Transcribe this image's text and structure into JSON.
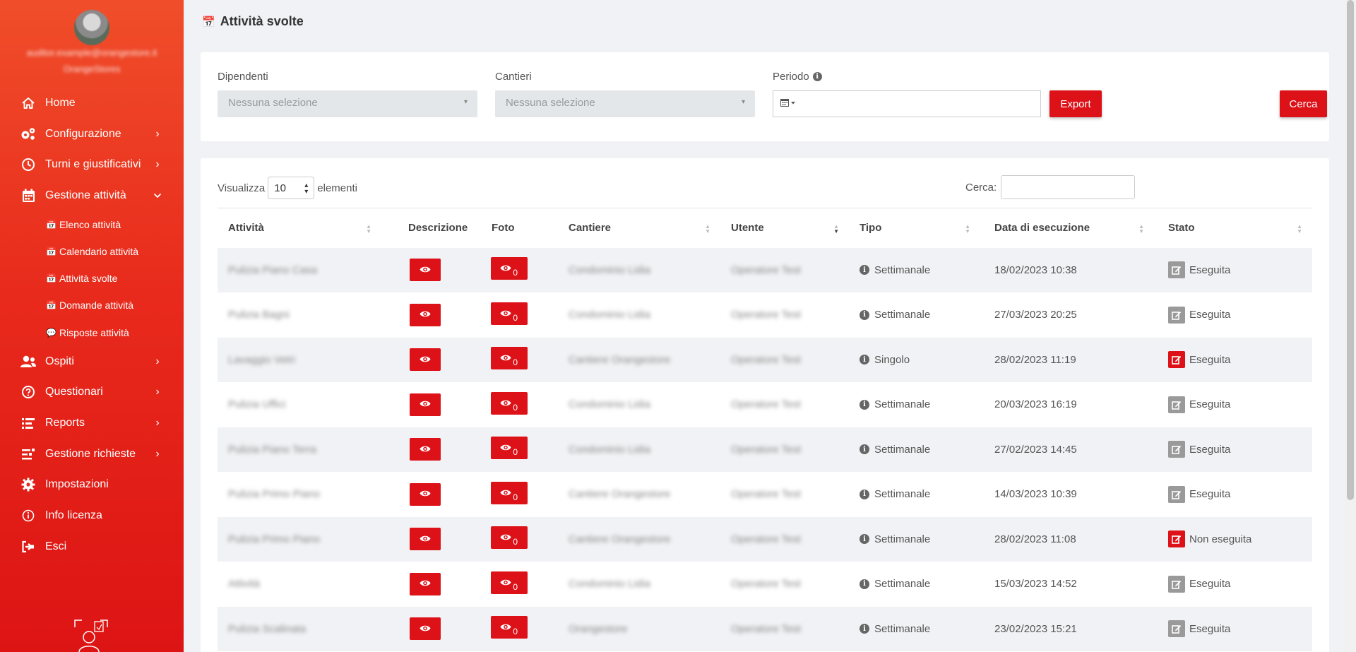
{
  "sidebar": {
    "email": "auditor.example@orangestore.it",
    "company": "OrangeStores",
    "nav": [
      {
        "label": "Home",
        "icon": "home-icon",
        "chevron": ""
      },
      {
        "label": "Configurazione",
        "icon": "gears-icon",
        "chevron": "›"
      },
      {
        "label": "Turni e giustificativi",
        "icon": "clock-icon",
        "chevron": "›"
      },
      {
        "label": "Gestione attività",
        "icon": "calendar-icon",
        "chevron": "⌄"
      }
    ],
    "subnav": [
      {
        "label": "Elenco attività",
        "icon": "calendar-small-icon"
      },
      {
        "label": "Calendario attività",
        "icon": "calendar-small-icon"
      },
      {
        "label": "Attività svolte",
        "icon": "calendar-check-icon"
      },
      {
        "label": "Domande attività",
        "icon": "calendar-question-icon"
      },
      {
        "label": "Risposte attività",
        "icon": "comment-icon"
      }
    ],
    "nav_bottom": [
      {
        "label": "Ospiti",
        "icon": "users-icon",
        "chevron": "›"
      },
      {
        "label": "Questionari",
        "icon": "question-icon",
        "chevron": "›"
      },
      {
        "label": "Reports",
        "icon": "reports-icon",
        "chevron": "›"
      },
      {
        "label": "Gestione richieste",
        "icon": "requests-icon",
        "chevron": "›"
      },
      {
        "label": "Impostazioni",
        "icon": "gear-icon",
        "chevron": ""
      },
      {
        "label": "Info licenza",
        "icon": "info-icon",
        "chevron": ""
      },
      {
        "label": "Esci",
        "icon": "logout-icon",
        "chevron": ""
      }
    ]
  },
  "page": {
    "title": "Attività svolte"
  },
  "filters": {
    "dipendenti_label": "Dipendenti",
    "dipendenti_value": "Nessuna selezione",
    "cantieri_label": "Cantieri",
    "cantieri_value": "Nessuna selezione",
    "periodo_label": "Periodo",
    "export_label": "Export",
    "cerca_label": "Cerca"
  },
  "table_controls": {
    "show_label": "Visualizza",
    "page_size": "10",
    "elements_label": "elementi",
    "search_label": "Cerca:"
  },
  "columns": [
    "Attività",
    "Descrizione",
    "Foto",
    "Cantiere",
    "Utente",
    "Tipo",
    "Data di esecuzione",
    "Stato"
  ],
  "rows": [
    {
      "attivita": "Pulizia Piano Casa",
      "foto_count": "0",
      "cantiere": "Condominio Lidia",
      "utente": "Operatore Test",
      "tipo": "Settimanale",
      "data": "18/02/2023 10:38",
      "stato": "Eseguita",
      "stato_color": "grey"
    },
    {
      "attivita": "Pulizia Bagni",
      "foto_count": "0",
      "cantiere": "Condominio Lidia",
      "utente": "Operatore Test",
      "tipo": "Settimanale",
      "data": "27/03/2023 20:25",
      "stato": "Eseguita",
      "stato_color": "grey"
    },
    {
      "attivita": "Lavaggio Vetri",
      "foto_count": "0",
      "cantiere": "Cantiere Orangestore",
      "utente": "Operatore Test",
      "tipo": "Singolo",
      "data": "28/02/2023 11:19",
      "stato": "Eseguita",
      "stato_color": "red"
    },
    {
      "attivita": "Pulizia Uffici",
      "foto_count": "0",
      "cantiere": "Condominio Lidia",
      "utente": "Operatore Test",
      "tipo": "Settimanale",
      "data": "20/03/2023 16:19",
      "stato": "Eseguita",
      "stato_color": "grey"
    },
    {
      "attivita": "Pulizia Piano Terra",
      "foto_count": "0",
      "cantiere": "Condominio Lidia",
      "utente": "Operatore Test",
      "tipo": "Settimanale",
      "data": "27/02/2023 14:45",
      "stato": "Eseguita",
      "stato_color": "grey"
    },
    {
      "attivita": "Pulizia Primo Piano",
      "foto_count": "0",
      "cantiere": "Cantiere Orangestore",
      "utente": "Operatore Test",
      "tipo": "Settimanale",
      "data": "14/03/2023 10:39",
      "stato": "Eseguita",
      "stato_color": "grey"
    },
    {
      "attivita": "Pulizia Primo Piano",
      "foto_count": "0",
      "cantiere": "Cantiere Orangestore",
      "utente": "Operatore Test",
      "tipo": "Settimanale",
      "data": "28/02/2023 11:08",
      "stato": "Non eseguita",
      "stato_color": "red"
    },
    {
      "attivita": "Attività",
      "foto_count": "0",
      "cantiere": "Condominio Lidia",
      "utente": "Operatore Test",
      "tipo": "Settimanale",
      "data": "15/03/2023 14:52",
      "stato": "Eseguita",
      "stato_color": "grey"
    },
    {
      "attivita": "Pulizia Scalinata",
      "foto_count": "0",
      "cantiere": "Orangestore",
      "utente": "Operatore Test",
      "tipo": "Settimanale",
      "data": "23/02/2023 15:21",
      "stato": "Eseguita",
      "stato_color": "grey"
    }
  ],
  "colors": {
    "brand_red": "#dd1219",
    "sidebar_top": "#f04e2a",
    "sidebar_bottom": "#dd1414",
    "stato_grey": "#9a9a9a"
  }
}
